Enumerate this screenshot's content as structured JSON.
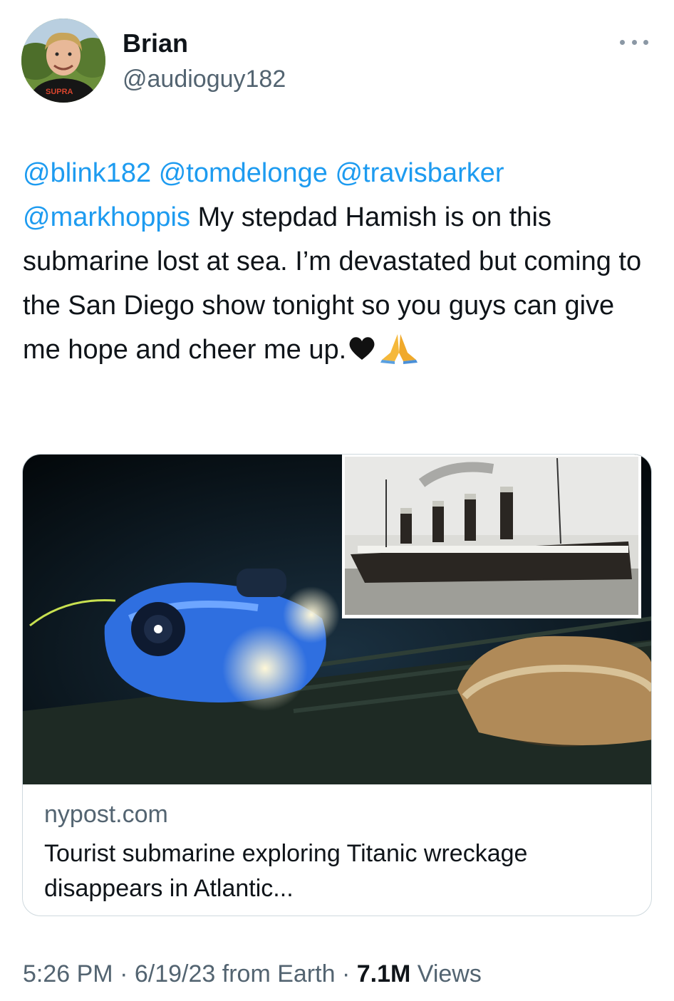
{
  "author": {
    "display_name": "Brian",
    "handle": "@audioguy182"
  },
  "tweet": {
    "mentions": [
      "@blink182",
      "@tomdelonge",
      "@travisbarker",
      "@markhoppis"
    ],
    "body": "My stepdad Hamish is on this submarine lost at sea. I’m devastated but coming to the San Diego show tonight so you guys can give me hope and cheer me up.",
    "emojis": [
      "black-heart",
      "folded-hands"
    ]
  },
  "link_card": {
    "domain": "nypost.com",
    "title": "Tourist submarine exploring Titanic wreckage disappears in Atlantic..."
  },
  "meta": {
    "time": "5:26 PM",
    "separator": "·",
    "date": "6/19/23",
    "source": "from Earth",
    "views_count": "7.1M",
    "views_label": "Views"
  },
  "colors": {
    "link": "#1d9bf0",
    "text": "#0f1419",
    "secondary": "#536471"
  }
}
